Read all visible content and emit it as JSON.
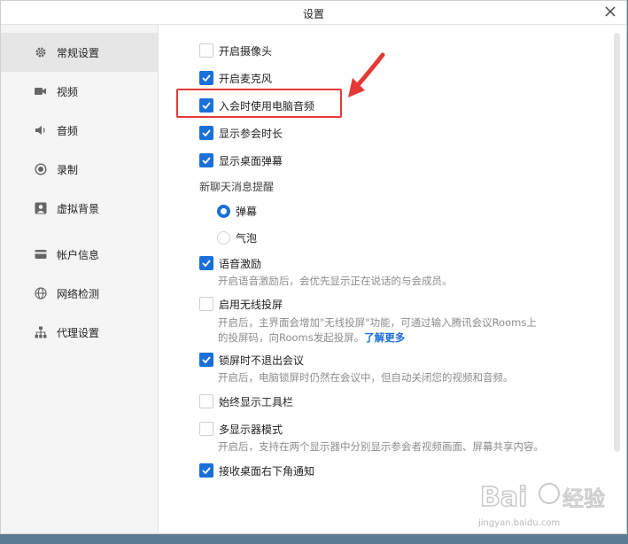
{
  "window": {
    "title": "设置"
  },
  "sidebar": {
    "items": [
      {
        "label": "常规设置",
        "icon": "gear-icon",
        "active": true
      },
      {
        "label": "视频",
        "icon": "video-camera-icon"
      },
      {
        "label": "音频",
        "icon": "speaker-icon"
      },
      {
        "label": "录制",
        "icon": "record-icon"
      },
      {
        "label": "虚拟背景",
        "icon": "portrait-icon"
      },
      {
        "label": "帐户信息",
        "icon": "card-icon"
      },
      {
        "label": "网络检测",
        "icon": "globe-icon"
      },
      {
        "label": "代理设置",
        "icon": "network-tree-icon"
      }
    ]
  },
  "settings": {
    "camera": {
      "label": "开启摄像头",
      "checked": false
    },
    "mic": {
      "label": "开启麦克风",
      "checked": true
    },
    "computer_audio": {
      "label": "入会时使用电脑音频",
      "checked": true
    },
    "show_duration": {
      "label": "显示参会时长",
      "checked": true
    },
    "desktop_danmaku": {
      "label": "显示桌面弹幕",
      "checked": true
    },
    "chat_section": {
      "title": "新聊天消息提醒",
      "options": [
        {
          "label": "弹幕",
          "selected": true
        },
        {
          "label": "气泡",
          "selected": false
        }
      ]
    },
    "voice_excitation": {
      "label": "语音激励",
      "checked": true,
      "desc": "开启语音激励后，会优先显示正在说话的与会成员。"
    },
    "wireless": {
      "label": "启用无线投屏",
      "checked": false,
      "desc1": "开启后，主界面会增加\"无线投屏\"功能，可通过输入腾讯会议Rooms上",
      "desc2": "的投屏码，向Rooms发起投屏。",
      "link": "了解更多"
    },
    "lock_screen": {
      "label": "锁屏时不退出会议",
      "checked": true,
      "desc": "开启后，电脑锁屏时仍然在会议中，但自动关闭您的视频和音频。"
    },
    "toolbar": {
      "label": "始终显示工具栏",
      "checked": false
    },
    "multi_display": {
      "label": "多显示器模式",
      "checked": false,
      "desc": "开启后，支持在两个显示器中分别显示参会者视频画面、屏幕共享内容。"
    },
    "desktop_notify": {
      "label": "接收桌面右下角通知",
      "checked": true
    }
  },
  "watermark": {
    "url": "jingyan.baidu.com"
  },
  "colors": {
    "accent": "#1b6fd8",
    "highlight": "#e53935"
  }
}
